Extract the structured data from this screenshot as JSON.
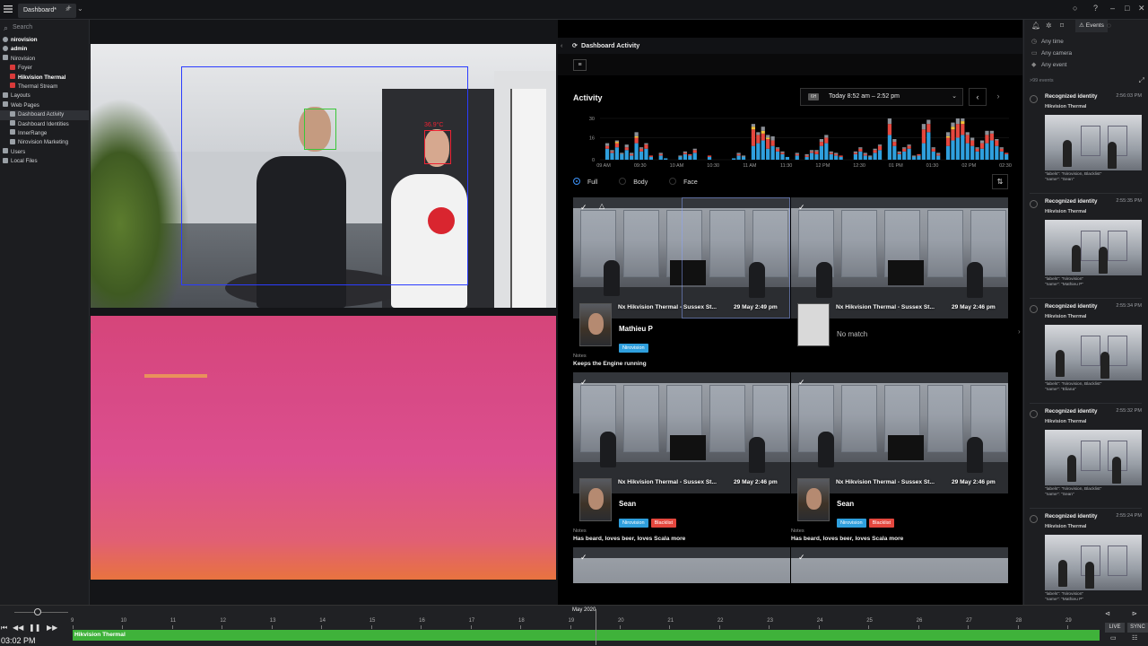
{
  "window": {
    "tab_label": "Dashboard*",
    "tab_close": "×",
    "new_tab": "+",
    "tab_menu": "⌄",
    "controls": [
      "○",
      "?",
      "–",
      "□",
      "✕"
    ]
  },
  "tree": {
    "search_placeholder": "Search",
    "items": [
      {
        "label": "nirovision",
        "level": 0,
        "bold": true
      },
      {
        "label": "admin",
        "level": 0,
        "bold": true
      },
      {
        "label": "Nirovision",
        "level": 0
      },
      {
        "label": "Foyer",
        "level": 1
      },
      {
        "label": "Hikvision Thermal",
        "level": 1,
        "bold": true
      },
      {
        "label": "Thermal Stream",
        "level": 1
      },
      {
        "label": "Layouts",
        "level": 0
      },
      {
        "label": "Web Pages",
        "level": 0
      },
      {
        "label": "Dashboard Activity",
        "level": 1,
        "selected": true
      },
      {
        "label": "Dashboard Identities",
        "level": 1
      },
      {
        "label": "InnerRange",
        "level": 1
      },
      {
        "label": "Nirovision Marketing",
        "level": 1
      },
      {
        "label": "Users",
        "level": 0
      },
      {
        "label": "Local Files",
        "level": 0
      }
    ]
  },
  "camera": {
    "temperature": "36.9°C"
  },
  "dashboard": {
    "header_title": "Dashboard Activity",
    "activity_title": "Activity",
    "range_badge": "6H",
    "range_label": "Today 8:52 am – 2:52 pm",
    "prev": "‹",
    "next": "›",
    "filters": [
      {
        "label": "Full",
        "selected": true
      },
      {
        "label": "Body"
      },
      {
        "label": "Face"
      }
    ],
    "cards": [
      {
        "camera": "Nx Hikvision Thermal - Sussex St...",
        "date": "29 May 2:49 pm",
        "name": "Mathieu P",
        "tags": [
          "Nirovision"
        ],
        "notes_label": "Notes",
        "notes": "Keeps the Engine running"
      },
      {
        "camera": "Nx Hikvision Thermal - Sussex St...",
        "date": "29 May 2:46 pm",
        "no_match": "No match"
      },
      {
        "camera": "Nx Hikvision Thermal - Sussex St...",
        "date": "29 May 2:46 pm",
        "name": "Sean",
        "tags": [
          "Nirovision",
          "Blacklist"
        ],
        "notes_label": "Notes",
        "notes": "Has beard, loves beer, loves Scala more"
      },
      {
        "camera": "Nx Hikvision Thermal - Sussex St...",
        "date": "29 May 2:46 pm",
        "name": "Sean",
        "tags": [
          "Nirovision",
          "Blacklist"
        ],
        "notes_label": "Notes",
        "notes": "Has beard, loves beer, loves Scala more"
      }
    ]
  },
  "chart_data": {
    "type": "bar",
    "stacked": true,
    "ylim": [
      0,
      30
    ],
    "yticks": [
      0,
      16,
      30
    ],
    "xticks": [
      "09 AM",
      "09:30",
      "10 AM",
      "10:30",
      "11 AM",
      "11:30",
      "12 PM",
      "12:30",
      "01 PM",
      "01:30",
      "02 PM",
      "02:30"
    ],
    "series_colors": [
      "#2f9fdd",
      "#e4473e",
      "#f0c23a",
      "#8b8f96"
    ],
    "values": [
      [
        0,
        0,
        0,
        0
      ],
      [
        8,
        2,
        0,
        2
      ],
      [
        5,
        1,
        0,
        1
      ],
      [
        9,
        3,
        1,
        1
      ],
      [
        4,
        0,
        0,
        1
      ],
      [
        7,
        2,
        0,
        2
      ],
      [
        3,
        1,
        0,
        1
      ],
      [
        12,
        4,
        1,
        3
      ],
      [
        6,
        2,
        0,
        1
      ],
      [
        8,
        3,
        0,
        1
      ],
      [
        2,
        1,
        0,
        0
      ],
      [
        0,
        0,
        0,
        0
      ],
      [
        3,
        1,
        0,
        1
      ],
      [
        1,
        0,
        0,
        0
      ],
      [
        0,
        0,
        0,
        0
      ],
      [
        0,
        0,
        0,
        0
      ],
      [
        2,
        0,
        0,
        1
      ],
      [
        4,
        1,
        0,
        1
      ],
      [
        3,
        1,
        0,
        0
      ],
      [
        5,
        2,
        0,
        1
      ],
      [
        0,
        0,
        0,
        0
      ],
      [
        0,
        0,
        0,
        0
      ],
      [
        2,
        1,
        0,
        0
      ],
      [
        0,
        0,
        0,
        0
      ],
      [
        0,
        0,
        0,
        0
      ],
      [
        0,
        0,
        0,
        0
      ],
      [
        0,
        0,
        0,
        0
      ],
      [
        1,
        0,
        0,
        0
      ],
      [
        3,
        1,
        0,
        1
      ],
      [
        2,
        0,
        0,
        1
      ],
      [
        0,
        0,
        0,
        0
      ],
      [
        10,
        12,
        2,
        2
      ],
      [
        12,
        6,
        0,
        2
      ],
      [
        14,
        5,
        2,
        3
      ],
      [
        8,
        7,
        1,
        2
      ],
      [
        10,
        4,
        0,
        3
      ],
      [
        6,
        2,
        0,
        1
      ],
      [
        4,
        1,
        0,
        1
      ],
      [
        2,
        0,
        0,
        0
      ],
      [
        0,
        0,
        0,
        0
      ],
      [
        3,
        1,
        0,
        1
      ],
      [
        0,
        0,
        0,
        0
      ],
      [
        2,
        1,
        0,
        1
      ],
      [
        5,
        1,
        0,
        1
      ],
      [
        4,
        2,
        0,
        1
      ],
      [
        10,
        3,
        0,
        2
      ],
      [
        12,
        4,
        0,
        2
      ],
      [
        4,
        1,
        0,
        1
      ],
      [
        3,
        1,
        0,
        1
      ],
      [
        2,
        1,
        0,
        0
      ],
      [
        0,
        0,
        0,
        0
      ],
      [
        0,
        0,
        0,
        0
      ],
      [
        4,
        1,
        0,
        1
      ],
      [
        6,
        2,
        0,
        1
      ],
      [
        3,
        1,
        0,
        1
      ],
      [
        2,
        0,
        0,
        1
      ],
      [
        5,
        2,
        0,
        1
      ],
      [
        7,
        3,
        0,
        1
      ],
      [
        0,
        0,
        0,
        0
      ],
      [
        18,
        8,
        0,
        4
      ],
      [
        10,
        3,
        0,
        2
      ],
      [
        4,
        1,
        0,
        1
      ],
      [
        6,
        2,
        0,
        1
      ],
      [
        8,
        2,
        0,
        1
      ],
      [
        2,
        0,
        0,
        1
      ],
      [
        3,
        1,
        0,
        0
      ],
      [
        12,
        10,
        0,
        4
      ],
      [
        20,
        6,
        0,
        3
      ],
      [
        6,
        2,
        0,
        1
      ],
      [
        3,
        1,
        0,
        1
      ],
      [
        0,
        0,
        0,
        0
      ],
      [
        10,
        6,
        1,
        3
      ],
      [
        14,
        8,
        2,
        3
      ],
      [
        16,
        10,
        0,
        4
      ],
      [
        18,
        8,
        2,
        2
      ],
      [
        12,
        6,
        0,
        2
      ],
      [
        10,
        4,
        0,
        2
      ],
      [
        6,
        2,
        0,
        1
      ],
      [
        8,
        4,
        0,
        2
      ],
      [
        12,
        6,
        0,
        3
      ],
      [
        14,
        5,
        0,
        2
      ],
      [
        10,
        4,
        0,
        1
      ],
      [
        6,
        2,
        0,
        1
      ],
      [
        4,
        1,
        0,
        0
      ]
    ]
  },
  "events": {
    "tab_label": "Events",
    "filters": [
      "Any time",
      "Any camera",
      "Any event"
    ],
    "count_label": ">99 events",
    "items": [
      {
        "title": "Recognized identity",
        "time": "2:56:03 PM",
        "camera": "Hikvision Thermal",
        "labels": "\"labels\": \"Nirovision, Blacklist\"\n\"name\": \"Sean\""
      },
      {
        "title": "Recognized identity",
        "time": "2:55:35 PM",
        "camera": "Hikvision Thermal",
        "labels": "\"labels\": \"Nirovision\"\n\"name\": \"Mathieu P\""
      },
      {
        "title": "Recognized identity",
        "time": "2:55:34 PM",
        "camera": "Hikvision Thermal",
        "labels": "\"labels\": \"Nirovision, Blacklist\"\n\"name\": \"Eliana\""
      },
      {
        "title": "Recognized identity",
        "time": "2:55:32 PM",
        "camera": "Hikvision Thermal",
        "labels": "\"labels\": \"Nirovision, Blacklist\"\n\"name\": \"Sean\""
      },
      {
        "title": "Recognized identity",
        "time": "2:55:24 PM",
        "camera": "Hikvision Thermal",
        "labels": "\"labels\": \"Nirovision\"\n\"name\": \"Mathieu P\""
      }
    ]
  },
  "timeline": {
    "current_time": "03:02 PM",
    "month_label": "May 2020",
    "days": [
      "9",
      "10",
      "11",
      "12",
      "13",
      "14",
      "15",
      "16",
      "17",
      "18",
      "19",
      "20",
      "21",
      "22",
      "23",
      "24",
      "25",
      "26",
      "27",
      "28",
      "29"
    ],
    "track_label": "Hikvision Thermal",
    "live_label": "LIVE",
    "sync_label": "SYNC"
  }
}
